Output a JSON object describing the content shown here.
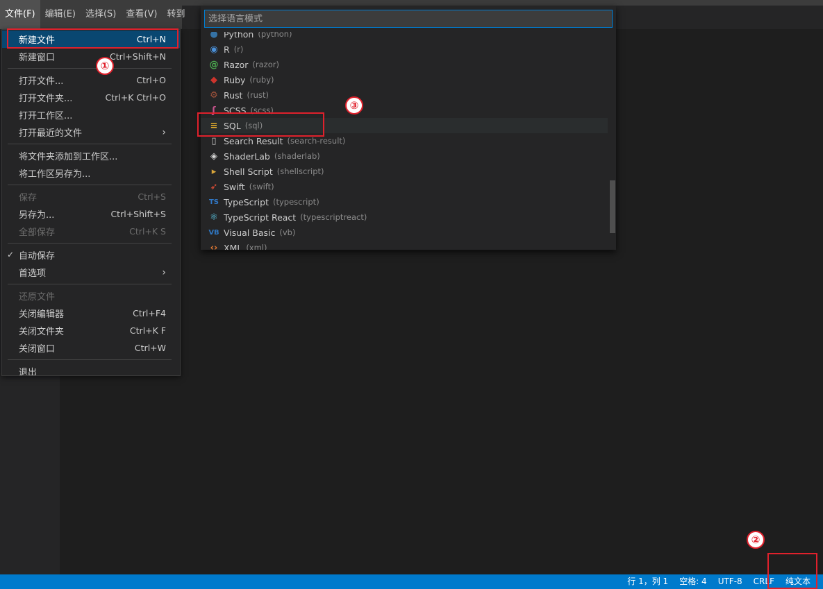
{
  "menubar": {
    "titles": [
      "文件(F)",
      "编辑(E)",
      "选择(S)",
      "查看(V)",
      "转到"
    ]
  },
  "file_menu": {
    "items": [
      {
        "label": "新建文件",
        "shortcut": "Ctrl+N"
      },
      {
        "label": "新建窗口",
        "shortcut": "Ctrl+Shift+N"
      },
      {
        "label": "打开文件...",
        "shortcut": "Ctrl+O"
      },
      {
        "label": "打开文件夹...",
        "shortcut": "Ctrl+K Ctrl+O"
      },
      {
        "label": "打开工作区...",
        "shortcut": ""
      },
      {
        "label": "打开最近的文件",
        "shortcut": ""
      },
      {
        "label": "将文件夹添加到工作区...",
        "shortcut": ""
      },
      {
        "label": "将工作区另存为...",
        "shortcut": ""
      },
      {
        "label": "保存",
        "shortcut": "Ctrl+S"
      },
      {
        "label": "另存为...",
        "shortcut": "Ctrl+Shift+S"
      },
      {
        "label": "全部保存",
        "shortcut": "Ctrl+K S"
      },
      {
        "label": "自动保存",
        "shortcut": "",
        "check": "✓"
      },
      {
        "label": "首选项",
        "shortcut": ""
      },
      {
        "label": "还原文件",
        "shortcut": ""
      },
      {
        "label": "关闭编辑器",
        "shortcut": "Ctrl+F4"
      },
      {
        "label": "关闭文件夹",
        "shortcut": "Ctrl+K F"
      },
      {
        "label": "关闭窗口",
        "shortcut": "Ctrl+W"
      },
      {
        "label": "退出",
        "shortcut": ""
      }
    ]
  },
  "language_picker": {
    "placeholder": "选择语言模式",
    "items": [
      {
        "name": "Python",
        "id": "(python)",
        "icon": "python-icon",
        "color": "#3572a5"
      },
      {
        "name": "R",
        "id": "(r)",
        "icon": "r-icon",
        "color": "#4a90d9"
      },
      {
        "name": "Razor",
        "id": "(razor)",
        "icon": "razor-icon",
        "color": "#4caf50"
      },
      {
        "name": "Ruby",
        "id": "(ruby)",
        "icon": "ruby-icon",
        "color": "#cc342d"
      },
      {
        "name": "Rust",
        "id": "(rust)",
        "icon": "rust-icon",
        "color": "#a0523a"
      },
      {
        "name": "SCSS",
        "id": "(scss)",
        "icon": "scss-icon",
        "color": "#c6538c"
      },
      {
        "name": "SQL",
        "id": "(sql)",
        "icon": "database-icon",
        "color": "#e8b02c"
      },
      {
        "name": "Search Result",
        "id": "(search-result)",
        "icon": "file-icon",
        "color": "#c5c5c5"
      },
      {
        "name": "ShaderLab",
        "id": "(shaderlab)",
        "icon": "unity-icon",
        "color": "#d4d4d4"
      },
      {
        "name": "Shell Script",
        "id": "(shellscript)",
        "icon": "terminal-icon",
        "color": "#d9a53a"
      },
      {
        "name": "Swift",
        "id": "(swift)",
        "icon": "swift-icon",
        "color": "#f05138"
      },
      {
        "name": "TypeScript",
        "id": "(typescript)",
        "icon": "ts-icon",
        "color": "#3178c6",
        "glyph": "TS"
      },
      {
        "name": "TypeScript React",
        "id": "(typescriptreact)",
        "icon": "react-icon",
        "color": "#61dafb"
      },
      {
        "name": "Visual Basic",
        "id": "(vb)",
        "icon": "vb-icon",
        "color": "#2f77c2",
        "glyph": "VB"
      },
      {
        "name": "XML",
        "id": "(xml)",
        "icon": "xml-icon",
        "color": "#e37933"
      }
    ]
  },
  "statusbar": {
    "position": "行 1，列 1",
    "spaces": "空格: 4",
    "encoding": "UTF-8",
    "eol": "CRLF",
    "language": "纯文本"
  },
  "annotations": {
    "badge1": "①",
    "badge2": "②",
    "badge3": "③"
  }
}
